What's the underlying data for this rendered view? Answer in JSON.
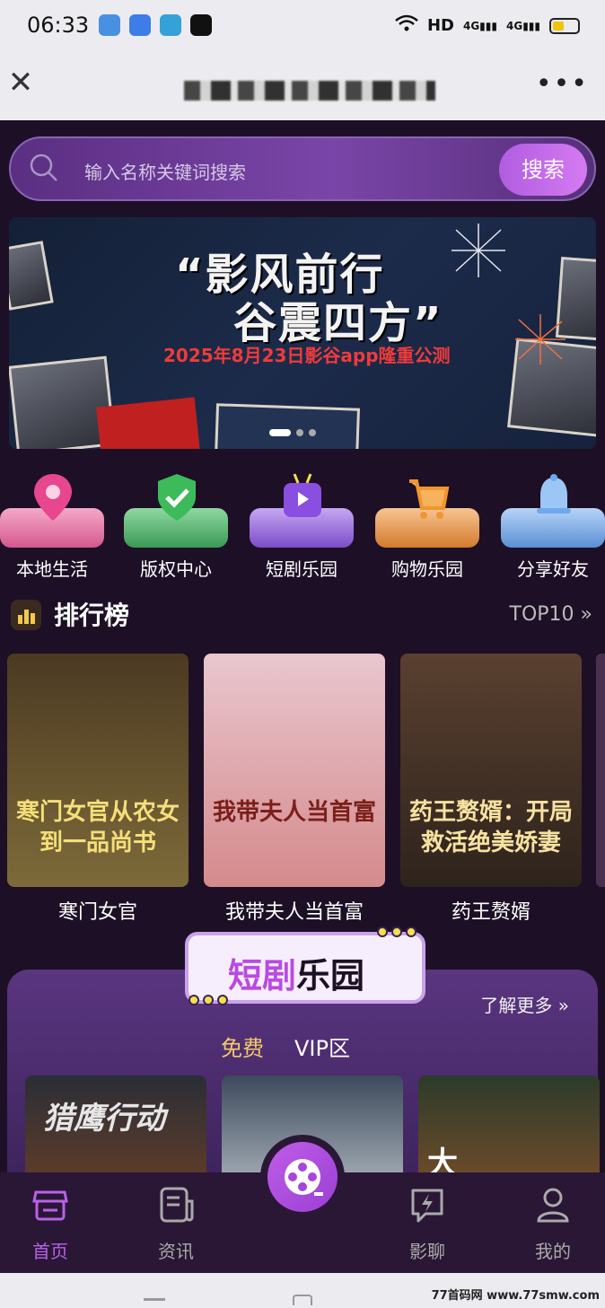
{
  "status_bar": {
    "time": "06:33",
    "network": "HD",
    "signal_1": "4G",
    "signal_2": "4G"
  },
  "title_bar": {
    "close_icon": "close-icon",
    "more_icon": "more-icon"
  },
  "search": {
    "placeholder": "输入名称关键词搜索",
    "button_label": "搜索"
  },
  "banner": {
    "headline_1": "“影风前行",
    "headline_2": "谷震四方”",
    "subtitle": "2025年8月23日影谷app隆重公测",
    "active_slide": 1,
    "slide_count": 3
  },
  "quick_links": [
    {
      "label": "本地生活",
      "icon": "location-pin-icon",
      "color": "#e8468f"
    },
    {
      "label": "版权中心",
      "icon": "shield-check-icon",
      "color": "#3dbb5a"
    },
    {
      "label": "短剧乐园",
      "icon": "tv-video-icon",
      "color": "#8a4ee0"
    },
    {
      "label": "购物乐园",
      "icon": "shopping-cart-icon",
      "color": "#f0962d"
    },
    {
      "label": "分享好友",
      "icon": "bell-icon",
      "color": "#6fa8f0"
    }
  ],
  "ranking": {
    "title": "排行榜",
    "more_label": "TOP10 »",
    "items": [
      {
        "name": "寒门女官",
        "poster_text": "寒门女官从农女到一品尚书",
        "color_top": "#4b3a22",
        "color_bottom": "#7d6a3a",
        "text_color": "#f5df7a"
      },
      {
        "name": "我带夫人当首富",
        "poster_text": "我带夫人当首富",
        "color_top": "#e9c7cf",
        "color_bottom": "#d58a8c",
        "text_color": "#7a1f1a"
      },
      {
        "name": "药王赘婿",
        "poster_text": "药王赘婿：开局救活绝美娇妻",
        "color_top": "#5a4030",
        "color_bottom": "#2e231c",
        "text_color": "#f7e2a0"
      }
    ]
  },
  "drama_section": {
    "tag_part_1": "短剧",
    "tag_part_2": "乐园",
    "learn_more": "了解更多 »",
    "tab_free": "免费",
    "tab_vip": "VIP区",
    "posters": [
      {
        "title": "猎鹰行动",
        "color_top": "#2a2e36",
        "color_bottom": "#5b3b2a"
      },
      {
        "title": "",
        "color_top": "#3d4a5c",
        "color_bottom": "#9aa3ad"
      },
      {
        "title": "大",
        "color_top": "#2b3b2a",
        "color_bottom": "#6a4a2a"
      }
    ]
  },
  "bottom_nav": [
    {
      "label": "首页",
      "icon": "store-icon",
      "active": true
    },
    {
      "label": "资讯",
      "icon": "news-icon",
      "active": false
    },
    {
      "label": "影聊",
      "icon": "chat-icon",
      "active": false
    },
    {
      "label": "我的",
      "icon": "user-icon",
      "active": false
    }
  ],
  "center_button_icon": "film-reel-icon",
  "watermark": "77首码网 www.77smw.com",
  "colors": {
    "app_bg": "#1d1026",
    "accent": "#b862e8",
    "search_button": "#c86ae8",
    "nav_bg": "#2a1735"
  }
}
